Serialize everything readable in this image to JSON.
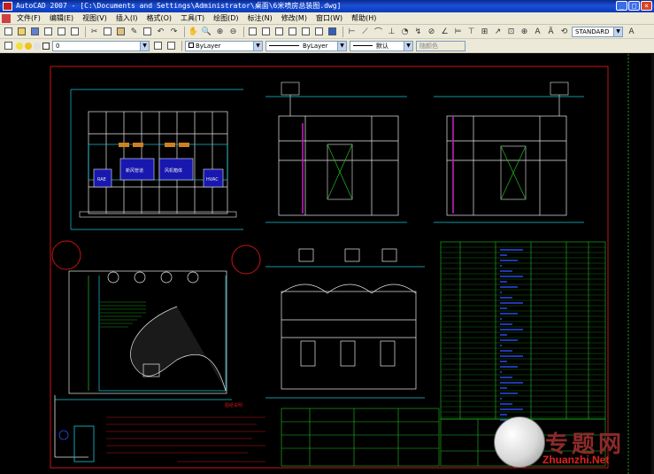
{
  "window": {
    "title": "AutoCAD 2007 - [C:\\Documents and Settings\\Administrator\\桌面\\6米喷房总装图.dwg]",
    "minimize": "_",
    "maximize": "□",
    "close": "×"
  },
  "menu": {
    "items": [
      "文件(F)",
      "编辑(E)",
      "视图(V)",
      "插入(I)",
      "格式(O)",
      "工具(T)",
      "绘图(D)",
      "标注(N)",
      "修改(M)",
      "窗口(W)",
      "帮助(H)"
    ]
  },
  "toolbar": {
    "text_style": "STANDARD"
  },
  "properties": {
    "layer": "0",
    "color": "ByLayer",
    "linetype": "ByLayer",
    "lineweight": "默认",
    "plotstyle": "随颜色"
  },
  "drawing": {
    "labels": {
      "note_1": "图纸说明",
      "cell_a": "RAE",
      "cell_b": "新风管道",
      "cell_c": "风机箱体",
      "cell_d": "HVAC"
    }
  },
  "watermark": {
    "logo_text": "专题网",
    "url": "Zhuanzhi.Net"
  },
  "colors": {
    "titlebar": "#1c4fd8",
    "background": "#000000",
    "drawing_border": "#c81414",
    "lines_white": "#e8e8e8",
    "lines_cyan": "#18c8d8",
    "lines_green": "#20c020",
    "lines_magenta": "#d020c8",
    "lines_blue": "#3048e8"
  }
}
